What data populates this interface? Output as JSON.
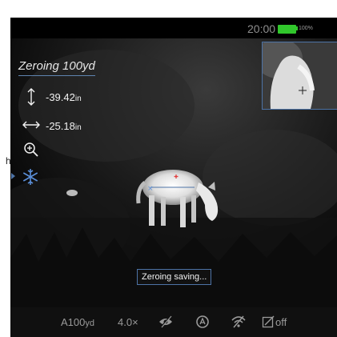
{
  "status": {
    "time": "20:00",
    "battery_percent": "100%",
    "battery_level": 1.0,
    "battery_color": "#31c72c"
  },
  "overlay": {
    "title": "Zeroing 100yd",
    "vertical_offset": {
      "value": "-39.42",
      "unit": "in",
      "icon": "vertical-arrows-icon"
    },
    "horizontal_offset": {
      "value": "-25.18",
      "unit": "in",
      "icon": "horizontal-arrows-icon"
    },
    "zoom_icon": "zoom-in-icon",
    "freeze_icon": "snowflake-icon",
    "accent_color": "#4d73a6"
  },
  "toast": {
    "text": "Zeroing saving..."
  },
  "bottom_bar": {
    "profile": "A100",
    "profile_unit": "yd",
    "zoom": "4.0×",
    "icons": [
      "hidden-eye-icon",
      "mode-circle-icon",
      "wifi-off-icon",
      "pip-edit-icon"
    ],
    "pip_state": "off"
  },
  "edge_char": "h"
}
